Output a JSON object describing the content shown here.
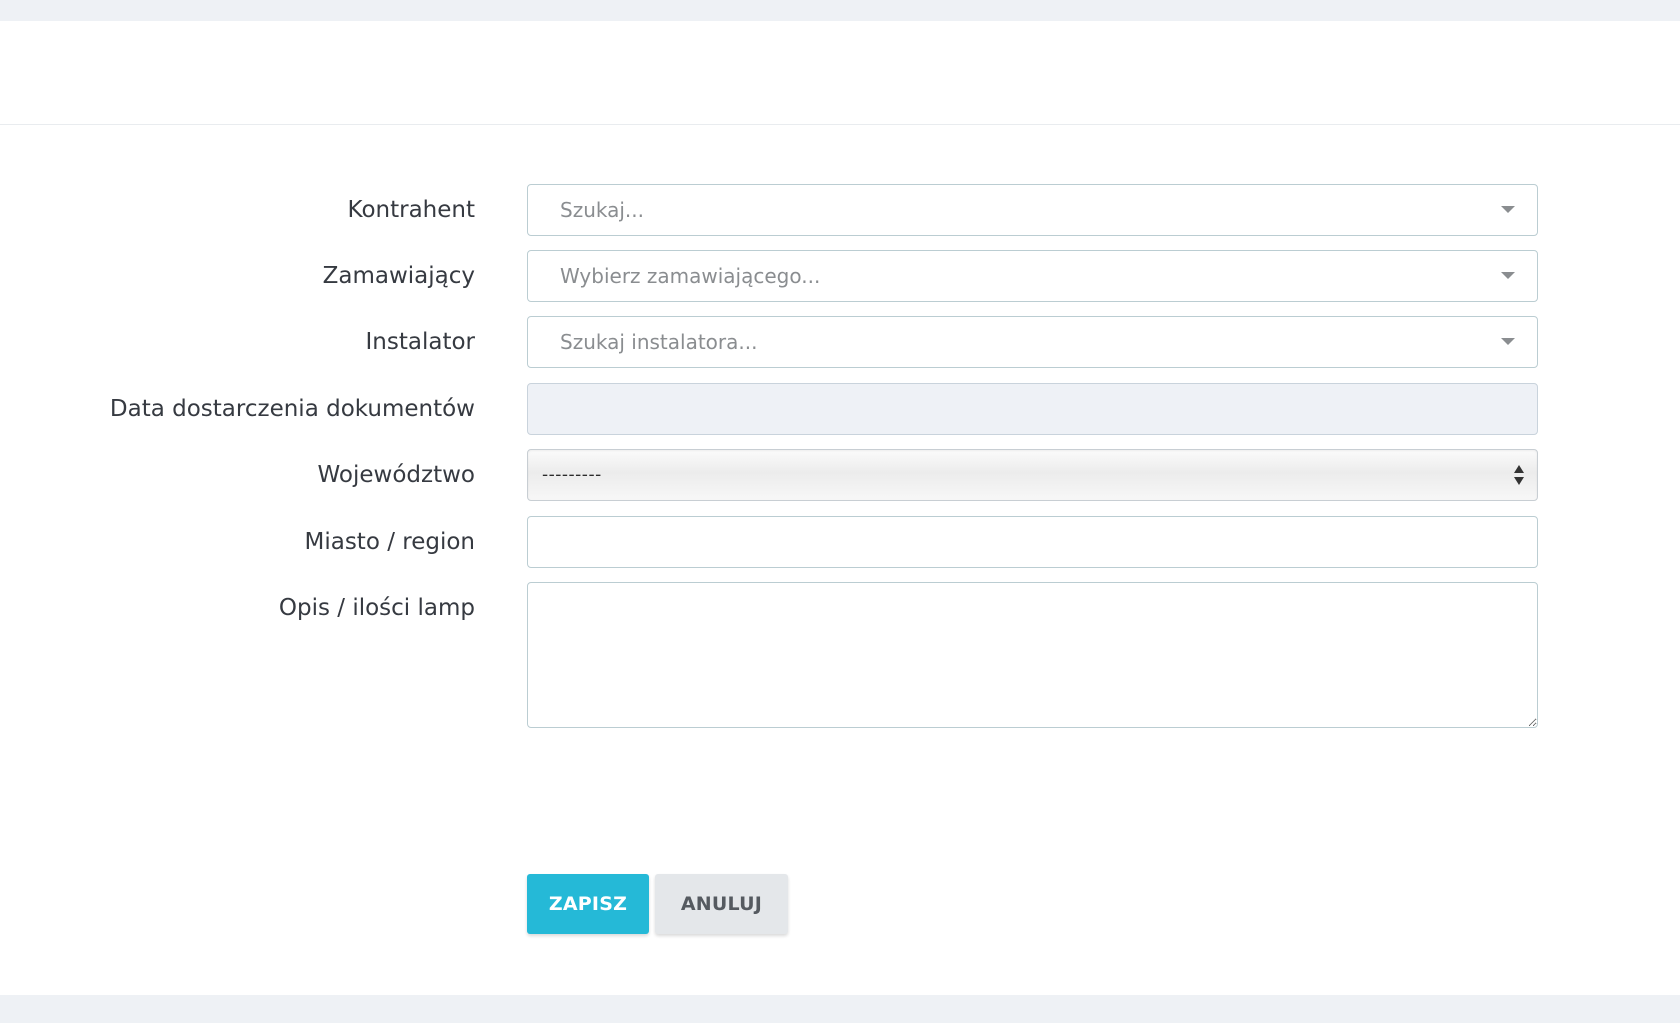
{
  "form": {
    "fields": [
      {
        "label": "Kontrahent",
        "type": "select2",
        "placeholder": "Szukaj..."
      },
      {
        "label": "Zamawiający",
        "type": "select2",
        "placeholder": "Wybierz zamawiającego..."
      },
      {
        "label": "Instalator",
        "type": "select2",
        "placeholder": "Szukaj instalatora..."
      },
      {
        "label": "Data dostarczenia dokumentów",
        "type": "date-disabled",
        "value": ""
      },
      {
        "label": "Województwo",
        "type": "select",
        "value": "---------"
      },
      {
        "label": "Miasto / region",
        "type": "text",
        "value": ""
      },
      {
        "label": "Opis / ilości lamp",
        "type": "textarea",
        "value": ""
      }
    ]
  },
  "actions": {
    "save_label": "ZAPISZ",
    "cancel_label": "ANULUJ"
  },
  "colors": {
    "accent": "#25b9d7",
    "page_background": "#eef1f5"
  },
  "icons": {
    "dropdown": "chevron-down-icon",
    "select_arrows": "up-down-arrows-icon",
    "resize": "resize-grip-icon"
  }
}
